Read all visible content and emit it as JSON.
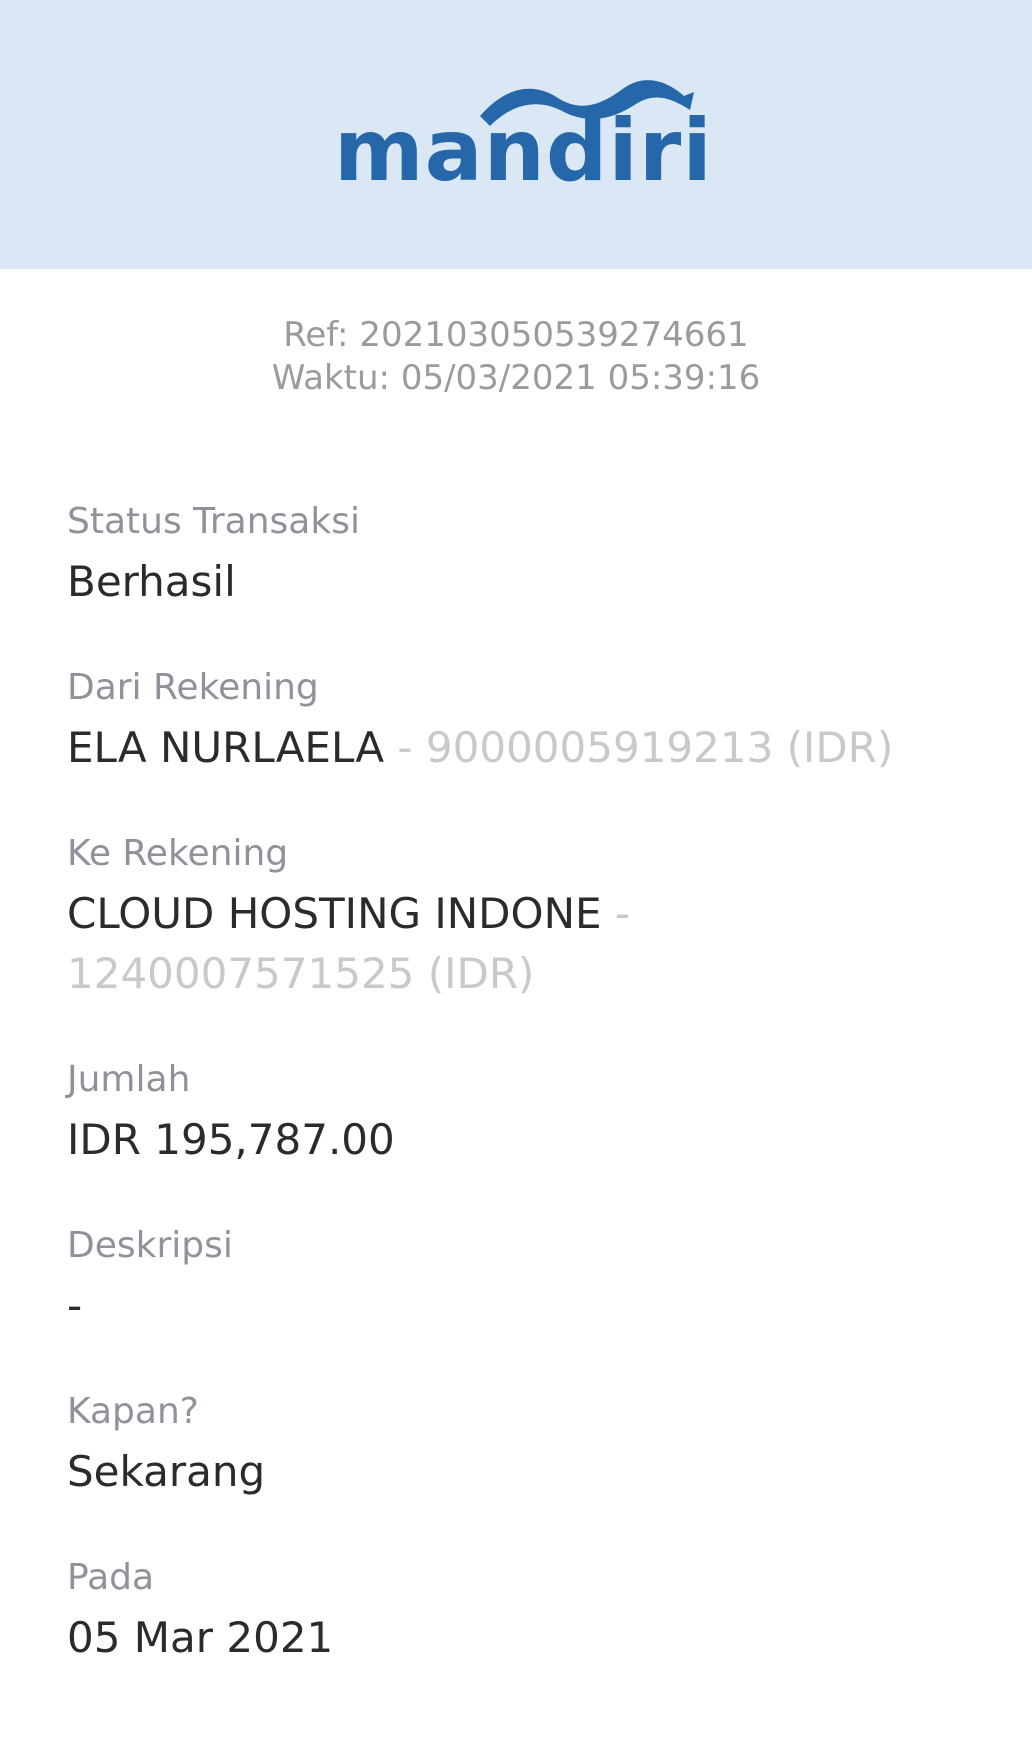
{
  "header": {
    "brand": "mandiri",
    "brand_color": "#2667AA",
    "background_color": "#DAE7F4"
  },
  "receipt": {
    "ref": "Ref: 2021030505392746​61",
    "time": "Waktu: 05/03/2021 05:39:16"
  },
  "fields": {
    "status": {
      "label": "Status Transaksi",
      "value": "Berhasil"
    },
    "from": {
      "label": "Dari Rekening",
      "name": "ELA NURLAELA",
      "account": " - 9000005919213 (IDR)"
    },
    "to": {
      "label": "Ke Rekening",
      "name": "CLOUD HOSTING INDONE",
      "account_sep": " -",
      "account": "1240007571525 (IDR)"
    },
    "amount": {
      "label": "Jumlah",
      "value": "IDR 195,787.00"
    },
    "description": {
      "label": "Deskripsi",
      "value": "-"
    },
    "when": {
      "label": "Kapan?",
      "value": "Sekarang"
    },
    "date": {
      "label": "Pada",
      "value": "05 Mar 2021"
    }
  }
}
